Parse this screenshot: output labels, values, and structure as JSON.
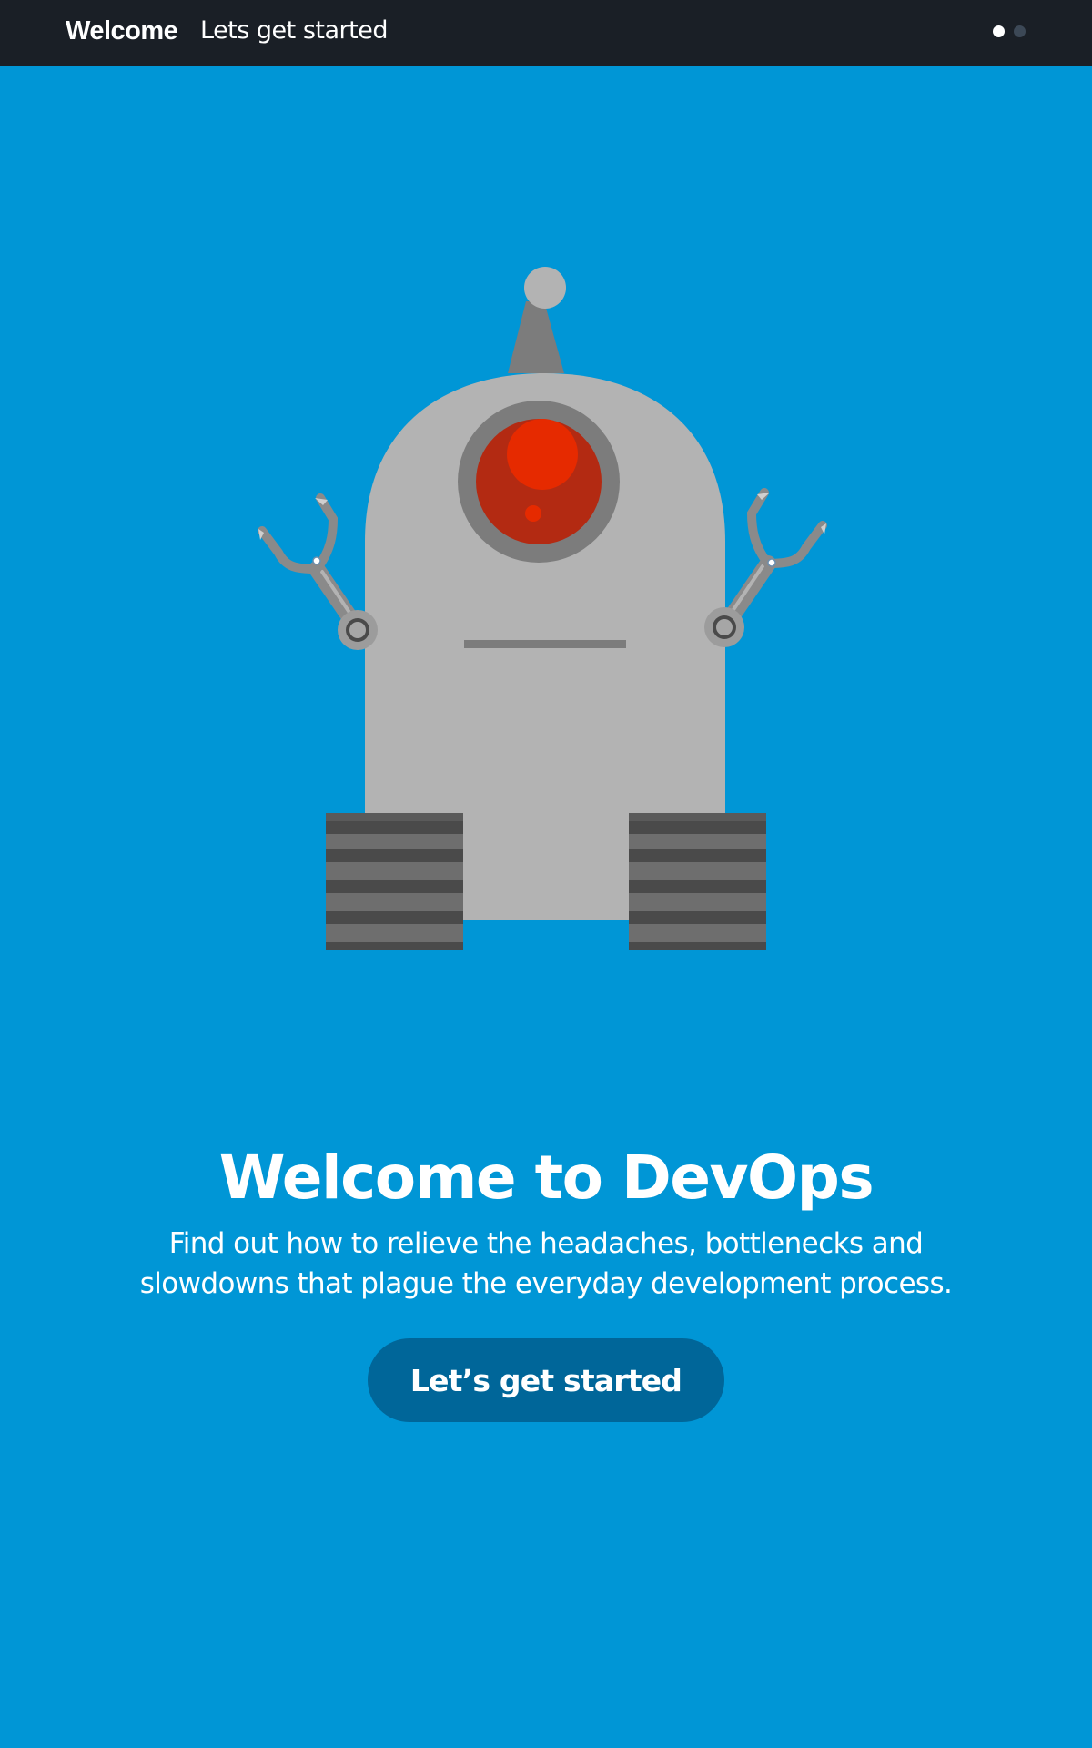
{
  "header": {
    "title": "Welcome",
    "subtitle": "Lets get started",
    "pagination": {
      "total": 2,
      "active_index": 0
    }
  },
  "hero": {
    "illustration": "robot-illustration",
    "colors": {
      "background": "#0096D6",
      "robot_body": "#B3B3B3",
      "eye": "#E62A00"
    }
  },
  "main": {
    "headline": "Welcome to DevOps",
    "body_line1": "Find out how to relieve the headaches, bottlenecks and",
    "body_line2": "slowdowns that plague the everyday development process.",
    "cta_label": "Let’s get started"
  }
}
